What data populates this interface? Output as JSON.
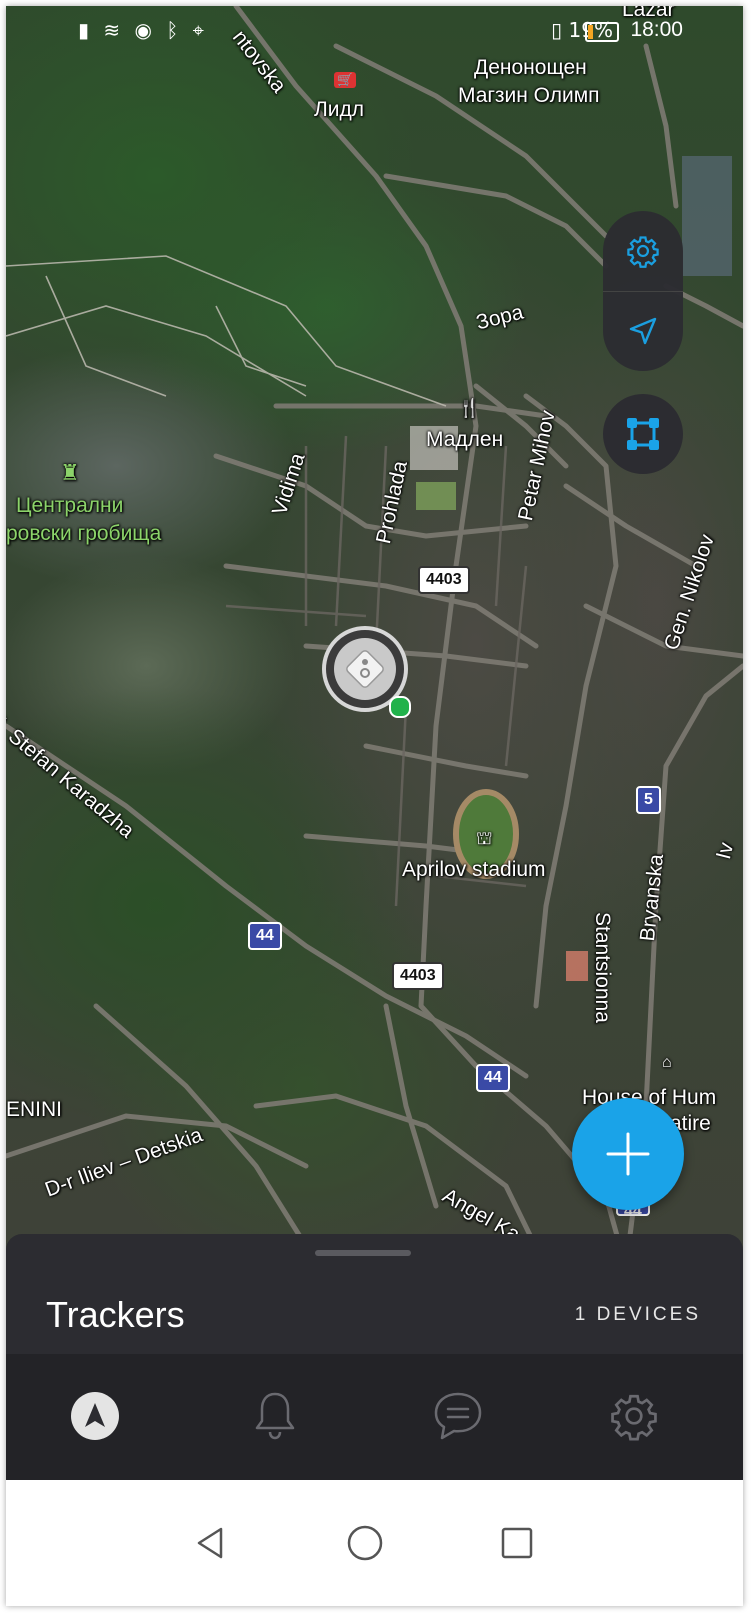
{
  "status_bar": {
    "icons": [
      "signal-icon",
      "wifi-icon",
      "eye-icon",
      "bluetooth-icon",
      "location-icon",
      "vibrate-icon",
      "alarm-icon",
      "battery-icon"
    ],
    "battery_text": "19%",
    "battery_level": 0.19,
    "time": "18:00"
  },
  "map": {
    "labels": {
      "street_top": "ntovska",
      "lidl": "Лидл",
      "shop_line1": "Денонощен",
      "shop_line2": "Магзин Олимп",
      "zora": "Зора",
      "madlen": "Мадлен",
      "cemetery_line1": "Централни",
      "cemetery_line2": "ровски гробища",
      "vidima": "Vidima",
      "prohlada": "Prohlada",
      "petar_mihov": "Petar Mihov",
      "gen_nikolov": "Gen. Nikolov",
      "stefan_karadzha": "l. Stefan Karadzha",
      "aprilov_stadium": "Aprilov stadium",
      "stantsionna": "Stantsionna",
      "bryanska": "Bryanska",
      "lenini": "ENINI",
      "iliev_detskia": "D-r Iliev – Detskia",
      "angel_ka": "Angel Ka",
      "house_line1": "House of Hum",
      "house_line2": "atire",
      "lazar": "Lazar",
      "edge_iv": "Iv"
    },
    "shields": {
      "r4403_a": "4403",
      "r4403_b": "4403",
      "r5": "5",
      "r44_a": "44",
      "r44_b": "44",
      "r44_c": "44"
    }
  },
  "controls": {
    "settings_icon": "gear-icon",
    "locate_icon": "navigation-arrow-icon",
    "fit_icon": "fit-devices-icon",
    "add_icon": "plus-icon"
  },
  "sheet": {
    "title": "Trackers",
    "device_count": "1 DEVICES"
  },
  "tabs": [
    {
      "icon": "navigation-icon",
      "active": true
    },
    {
      "icon": "bell-icon",
      "active": false
    },
    {
      "icon": "chat-icon",
      "active": false
    },
    {
      "icon": "settings-icon",
      "active": false
    }
  ],
  "colors": {
    "accent": "#1aa3e8",
    "panel": "#2c2c31",
    "tabbar": "#232327",
    "online": "#21b24b"
  }
}
